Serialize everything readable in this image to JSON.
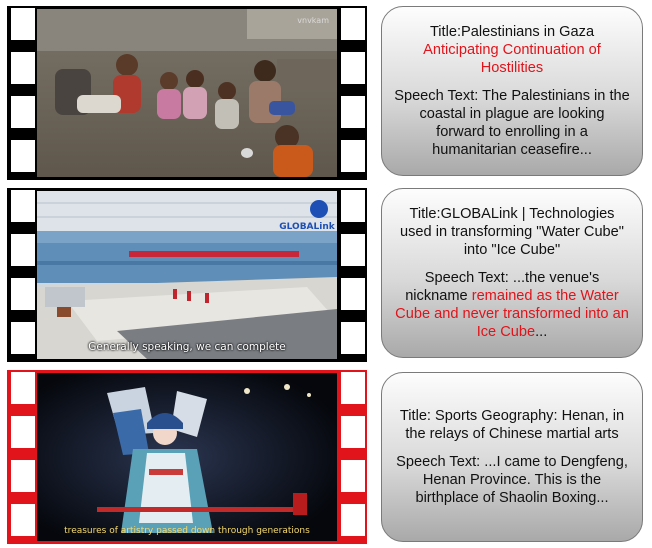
{
  "panels": [
    {
      "frame_style": "black",
      "watermark": "vnvkam",
      "title_prefix": "Title:Palestinians in Gaza",
      "title_highlight": "Anticipating Continuation of Hostilities",
      "speech_prefix": "Speech Text: The Palestinians in the coastal in plague are looking forward to enrolling in a humanitarian ceasefire...",
      "speech_highlight": "",
      "speech_suffix": ""
    },
    {
      "frame_style": "black",
      "logo_text": "GLOBALink",
      "subtitle": "Generally speaking, we can complete",
      "title_prefix": "Title:GLOBALink | Technologies used in transforming \"Water Cube\" into \"Ice Cube\"",
      "title_highlight": "",
      "speech_prefix": "Speech Text: ...the venue's nickname ",
      "speech_highlight": "remained as the Water Cube and never transformed into an Ice Cube",
      "speech_suffix": "..."
    },
    {
      "frame_style": "red",
      "subtitle": "treasures of artistry passed down through generations",
      "title_prefix": "Title: Sports Geography: Henan, in the relays of Chinese martial arts",
      "title_highlight": "",
      "speech_prefix": "Speech Text: ...I came to Dengfeng, Henan Province. This is the birthplace of Shaolin Boxing...",
      "speech_highlight": "",
      "speech_suffix": ""
    }
  ],
  "colors": {
    "highlight": "#e0141a",
    "frame_black": "#000000",
    "frame_red": "#e0141a"
  }
}
